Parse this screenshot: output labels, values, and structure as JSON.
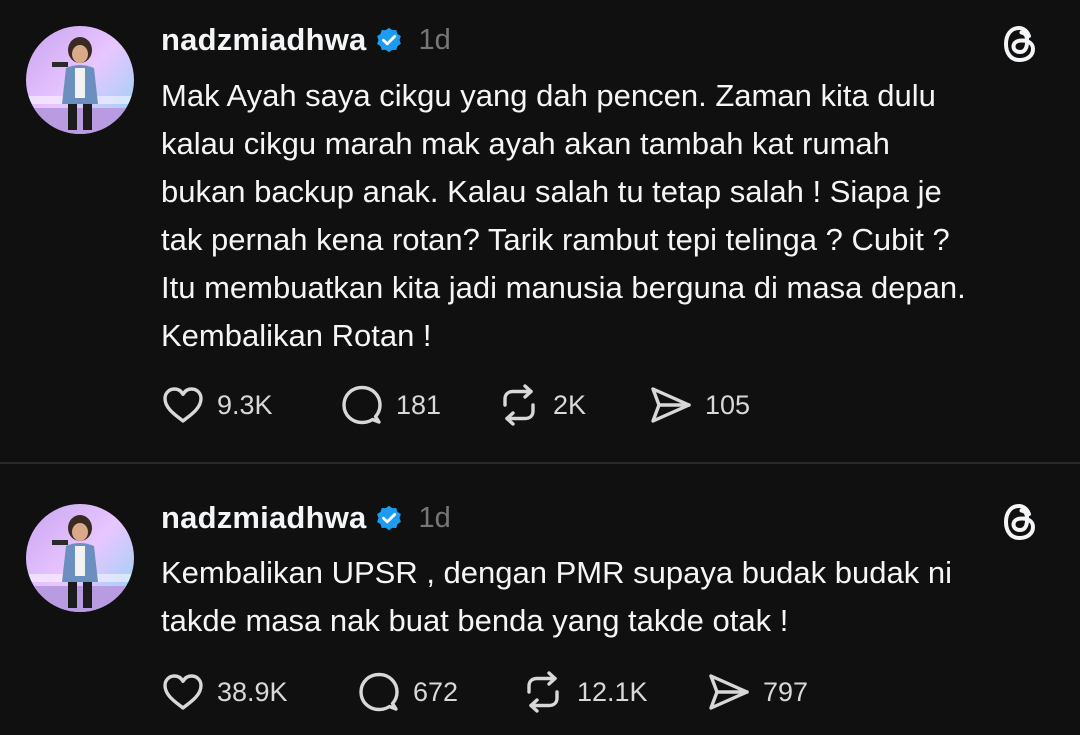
{
  "posts": [
    {
      "username": "nadzmiadhwa",
      "time": "1d",
      "text": "Mak Ayah saya cikgu yang dah pencen. Zaman kita dulu\nkalau cikgu marah mak ayah akan tambah kat rumah\nbukan backup anak. Kalau salah tu tetap salah ! Siapa je\ntak pernah kena rotan? Tarik rambut tepi telinga ? Cubit ?\nItu membuatkan kita jadi manusia berguna di masa depan.\nKembalikan Rotan !",
      "likes": "9.3K",
      "replies": "181",
      "reposts": "2K",
      "shares": "105"
    },
    {
      "username": "nadzmiadhwa",
      "time": "1d",
      "text": "Kembalikan UPSR , dengan PMR supaya budak budak ni\ntakde masa nak buat benda yang takde otak !",
      "likes": "38.9K",
      "replies": "672",
      "reposts": "12.1K",
      "shares": "797"
    }
  ],
  "icons": {
    "verified": "verified-badge-icon",
    "threads": "threads-logo-icon",
    "like": "heart-icon",
    "reply": "comment-bubble-icon",
    "repost": "repost-icon",
    "share": "send-icon"
  },
  "colors": {
    "background": "#101010",
    "text": "#f3f5f7",
    "muted": "#777777",
    "verified": "#1d9bf0"
  }
}
